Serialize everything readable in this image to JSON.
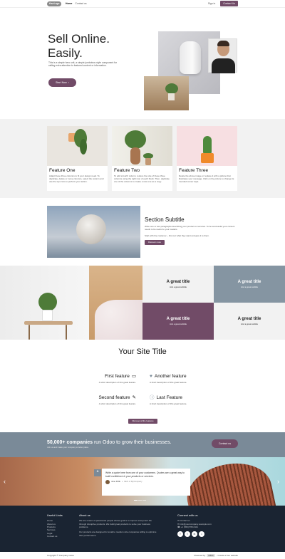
{
  "header": {
    "logo": "YourLogo",
    "nav": [
      "Home",
      "Contact us"
    ],
    "sign_in": "Sign in",
    "contact_button": "Contact Us"
  },
  "hero": {
    "title_line1": "Sell Online.",
    "title_line2": "Easily.",
    "text": "This is a simple hero unit, a simple jumbotron-style component for calling extra attention to featured content or information.",
    "button": "Start Now"
  },
  "features": [
    {
      "title": "Feature One",
      "text": "Adapt these three columns to fit your design need. To duplicate, delete or move columns, select the column and use the top icons to perform your action."
    },
    {
      "title": "Feature Two",
      "text": "To add a fourth column, reduce the size of these three columns using the right icon of each block. Then, duplicate one of the columns to create a new one as a copy."
    },
    {
      "title": "Feature Three",
      "text": "Delete the above image or replace it with a picture that illustrates your message. Click on the picture to change its rounded corner style."
    }
  ],
  "section": {
    "title": "Section Subtitle",
    "text": "Write one or two paragraphs describing your product or services. To be successful your content needs to be useful to your readers.",
    "text2": "Start with the customer – find out what they want and give it to them.",
    "button": "Discover more"
  },
  "tiles": [
    {
      "title": "A great title",
      "subtitle": "And a great subtitle"
    },
    {
      "title": "A great title",
      "subtitle": "And a great subtitle"
    },
    {
      "title": "A great title",
      "subtitle": "And a great subtitle"
    },
    {
      "title": "A great title",
      "subtitle": "And a great subtitle"
    }
  ],
  "site": {
    "title": "Your Site Title",
    "features": [
      {
        "title": "First feature",
        "desc": "A short description of this great feature."
      },
      {
        "title": "Another feature",
        "desc": "A short description of this great feature."
      },
      {
        "title": "Second feature",
        "desc": "A short description of this great feature."
      },
      {
        "title": "Last Feature",
        "desc": "A short description of this great feature."
      }
    ],
    "button": "Discover all the features"
  },
  "banner": {
    "title_bold": "50,000+ companies",
    "title_rest": " run Odoo to grow their businesses.",
    "subtitle": "Join us and make your company a better place.",
    "button": "Contact us"
  },
  "testimonial": {
    "quote": "Write a quote here from one of your customers. Quotes are a great way to ",
    "quote_em": "build confidence in your products or services.",
    "author": "Jane DOE",
    "role": "CEO of MyCompany"
  },
  "footer": {
    "useful_title": "Useful Links",
    "useful_links": [
      "Home",
      "About us",
      "Products",
      "Services",
      "Legal",
      "Contact us"
    ],
    "about_title": "About us",
    "about_text1": "We are a team of passionate people whose goal is to improve everyone's life through disruptive products. We build great products to solve your business problems.",
    "about_text2": "Our products are designed for small to medium size companies willing to optimize their performance.",
    "connect_title": "Connect with us",
    "connect_items": [
      "Contact us",
      "info@yourcompany.example.com",
      "+1 (650) 555-0111"
    ],
    "copyright": "Copyright © Company name",
    "powered_by": "Powered by",
    "powered_brand": "odoo",
    "powered_rest": "- Create a free website"
  }
}
